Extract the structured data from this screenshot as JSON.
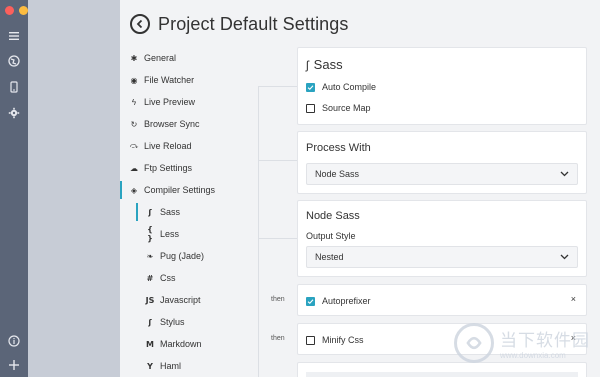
{
  "window": {
    "traffic_lights": [
      "#fc605c",
      "#fdbc40",
      "#34c84a"
    ]
  },
  "rail": {
    "icons": [
      "menu-icon",
      "globe-icon",
      "device-icon",
      "gear-icon",
      "info-icon",
      "plus-icon"
    ]
  },
  "header": {
    "title": "Project Default Settings"
  },
  "nav": {
    "items": [
      {
        "label": "General",
        "icon": "gear-icon"
      },
      {
        "label": "File Watcher",
        "icon": "eye-icon"
      },
      {
        "label": "Live Preview",
        "icon": "bolt-icon"
      },
      {
        "label": "Browser Sync",
        "icon": "sync-icon"
      },
      {
        "label": "Live Reload",
        "icon": "reload-icon"
      },
      {
        "label": "Ftp Settings",
        "icon": "cloud-upload-icon"
      },
      {
        "label": "Compiler Settings",
        "icon": "layers-icon"
      }
    ],
    "sub_items": [
      {
        "label": "Sass",
        "glyph": "ʃ"
      },
      {
        "label": "Less",
        "glyph": "{ }"
      },
      {
        "label": "Pug (Jade)",
        "glyph": "❧"
      },
      {
        "label": "Css",
        "glyph": "#"
      },
      {
        "label": "Javascript",
        "glyph": "JS"
      },
      {
        "label": "Stylus",
        "glyph": "ʃ"
      },
      {
        "label": "Markdown",
        "glyph": "M"
      },
      {
        "label": "Haml",
        "glyph": "Y"
      }
    ]
  },
  "sass_card": {
    "title": "Sass",
    "auto_compile": "Auto Compile",
    "source_map": "Source Map"
  },
  "process_card": {
    "title": "Process With",
    "selected": "Node Sass"
  },
  "node_sass_card": {
    "title": "Node Sass",
    "output_style_label": "Output Style",
    "output_style_value": "Nested"
  },
  "autoprefixer": {
    "then": "then",
    "label": "Autoprefixer",
    "close": "×"
  },
  "minify": {
    "then": "then",
    "label": "Minify Css",
    "close": "×"
  },
  "watermark": {
    "brand": "当下软件园",
    "url": "www.downxia.com"
  },
  "colors": {
    "accent": "#2aa3c0",
    "rail": "#5b6578"
  }
}
